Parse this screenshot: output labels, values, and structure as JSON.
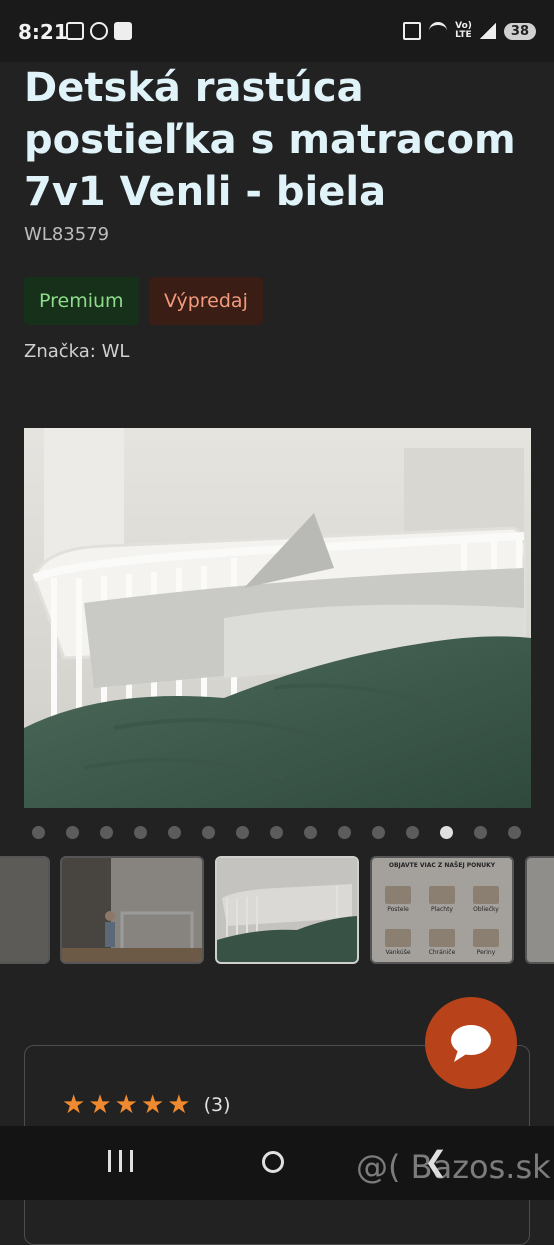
{
  "status_bar": {
    "time": "8:21",
    "lte_label": "Vo)\nLTE",
    "battery": "38"
  },
  "product": {
    "title": "Detská rastúca postieľka s matracom 7v1 Venli - biela",
    "sku": "WL83579",
    "badges": [
      "Premium",
      "Výpredaj"
    ],
    "brand": "Značka: WL"
  },
  "gallery": {
    "dot_count": 15,
    "active_dot_index": 12
  },
  "offer_thumb": {
    "heading": "OBJAVTE VIAC Z NAŠEJ PONUKY",
    "items": [
      "Postele",
      "Plachty",
      "Obliečky",
      "Vankúše",
      "Chrániče",
      "Periny"
    ]
  },
  "reviews": {
    "rating_stars": 5,
    "count_label": "(3)"
  },
  "watermark": "@( Bazos.sk",
  "colors": {
    "accent_fab": "#b8431a",
    "star": "#f08a2e",
    "title": "#e0f3f9"
  }
}
